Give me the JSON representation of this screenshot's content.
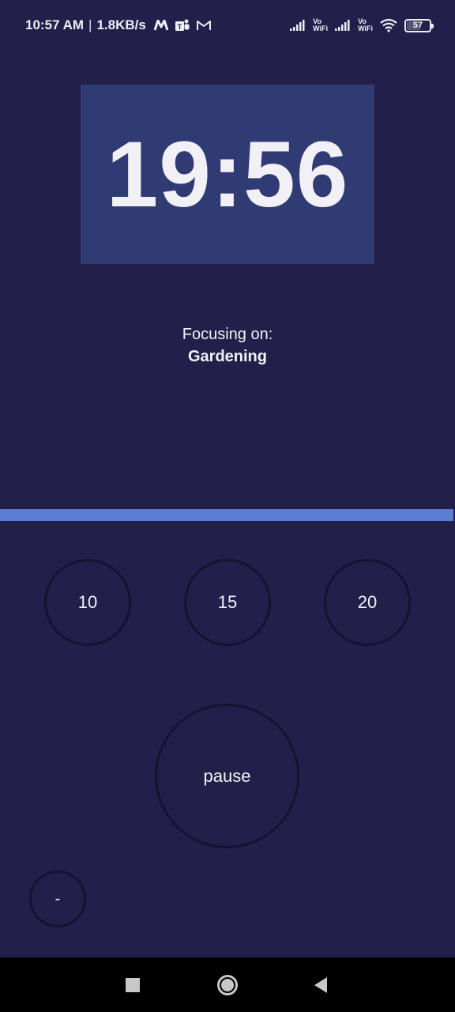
{
  "status_bar": {
    "time": "10:57 AM",
    "separator": "|",
    "network_speed": "1.8KB/s",
    "app_icons": [
      "myntra-icon",
      "teams-icon",
      "gmail-icon"
    ],
    "sim1_label_top": "Vo",
    "sim1_label_bottom": "WiFi",
    "sim2_label_top": "Vo",
    "sim2_label_bottom": "WiFi",
    "battery_percent": "57"
  },
  "timer": {
    "display": "19:56"
  },
  "focus": {
    "label": "Focusing on:",
    "task": "Gardening"
  },
  "progress": {
    "value": 0.997
  },
  "presets": {
    "btn1": "10",
    "btn2": "15",
    "btn3": "20"
  },
  "controls": {
    "pause": "pause",
    "minus": "-"
  },
  "colors": {
    "background": "#22204b",
    "timer_box": "#303a73",
    "progress": "#5a7ed3",
    "button_border": "#141430"
  }
}
